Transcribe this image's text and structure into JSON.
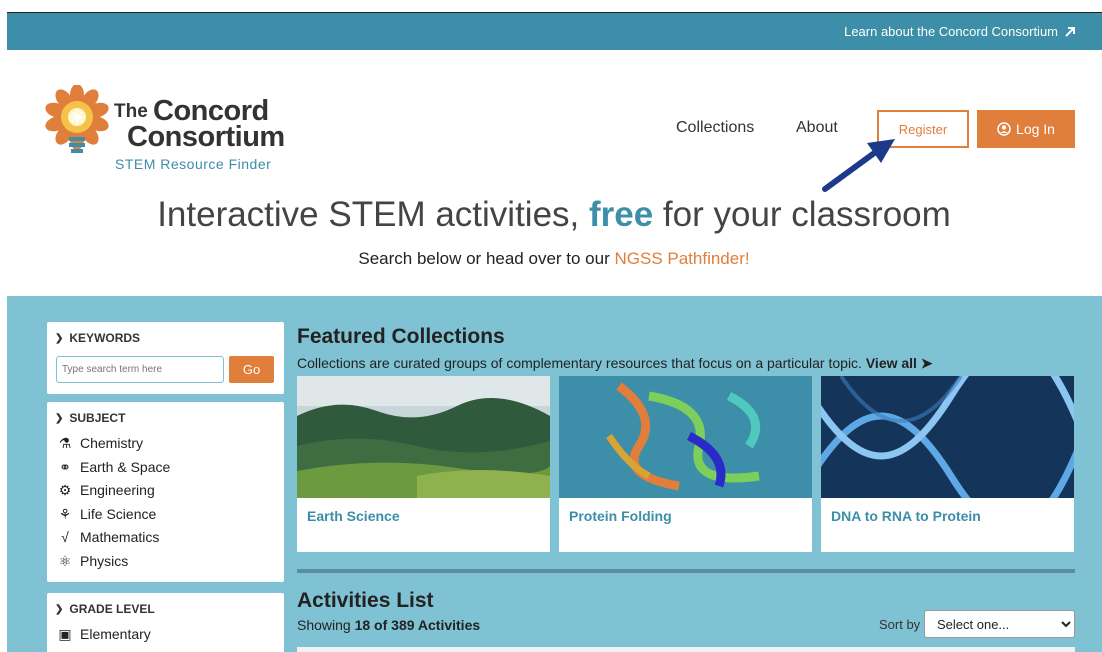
{
  "topbar": {
    "external_link": "Learn about the Concord Consortium"
  },
  "logo": {
    "the": "The",
    "concord": "Concord",
    "consortium": "Consortium",
    "subtitle": "STEM Resource Finder"
  },
  "nav": {
    "collections": "Collections",
    "about": "About",
    "register": "Register",
    "login": "Log In"
  },
  "hero": {
    "title_pre": "Interactive STEM activities, ",
    "title_free": "free",
    "title_post": " for your classroom",
    "sub_pre": "Search below or head over to our ",
    "sub_link": "NGSS Pathfinder!"
  },
  "filters": {
    "keywords": {
      "title": "KEYWORDS",
      "placeholder": "Type search term here",
      "go": "Go"
    },
    "subject": {
      "title": "SUBJECT",
      "items": [
        {
          "label": "Chemistry",
          "icon": "flask-icon"
        },
        {
          "label": "Earth & Space",
          "icon": "planet-icon"
        },
        {
          "label": "Engineering",
          "icon": "gear-icon"
        },
        {
          "label": "Life Science",
          "icon": "microscope-icon"
        },
        {
          "label": "Mathematics",
          "icon": "sqrt-icon"
        },
        {
          "label": "Physics",
          "icon": "atom-icon"
        }
      ]
    },
    "grade": {
      "title": "GRADE LEVEL",
      "items": [
        {
          "label": "Elementary",
          "icon": "bus-icon"
        }
      ]
    }
  },
  "featured": {
    "title": "Featured Collections",
    "desc": "Collections are curated groups of complementary resources that focus on a particular topic.",
    "view_all": "View all",
    "cards": [
      {
        "label": "Earth Science"
      },
      {
        "label": "Protein Folding"
      },
      {
        "label": "DNA to RNA to Protein"
      }
    ]
  },
  "activities": {
    "title": "Activities List",
    "showing_pre": "Showing ",
    "showing_count": "18 of 389 Activities",
    "sort_label": "Sort by",
    "sort_value": "Select one..."
  },
  "colors": {
    "teal": "#3d8ea8",
    "orange": "#e07e3c",
    "light_blue": "#7fc2d4",
    "arrow": "#1b3a8a"
  }
}
